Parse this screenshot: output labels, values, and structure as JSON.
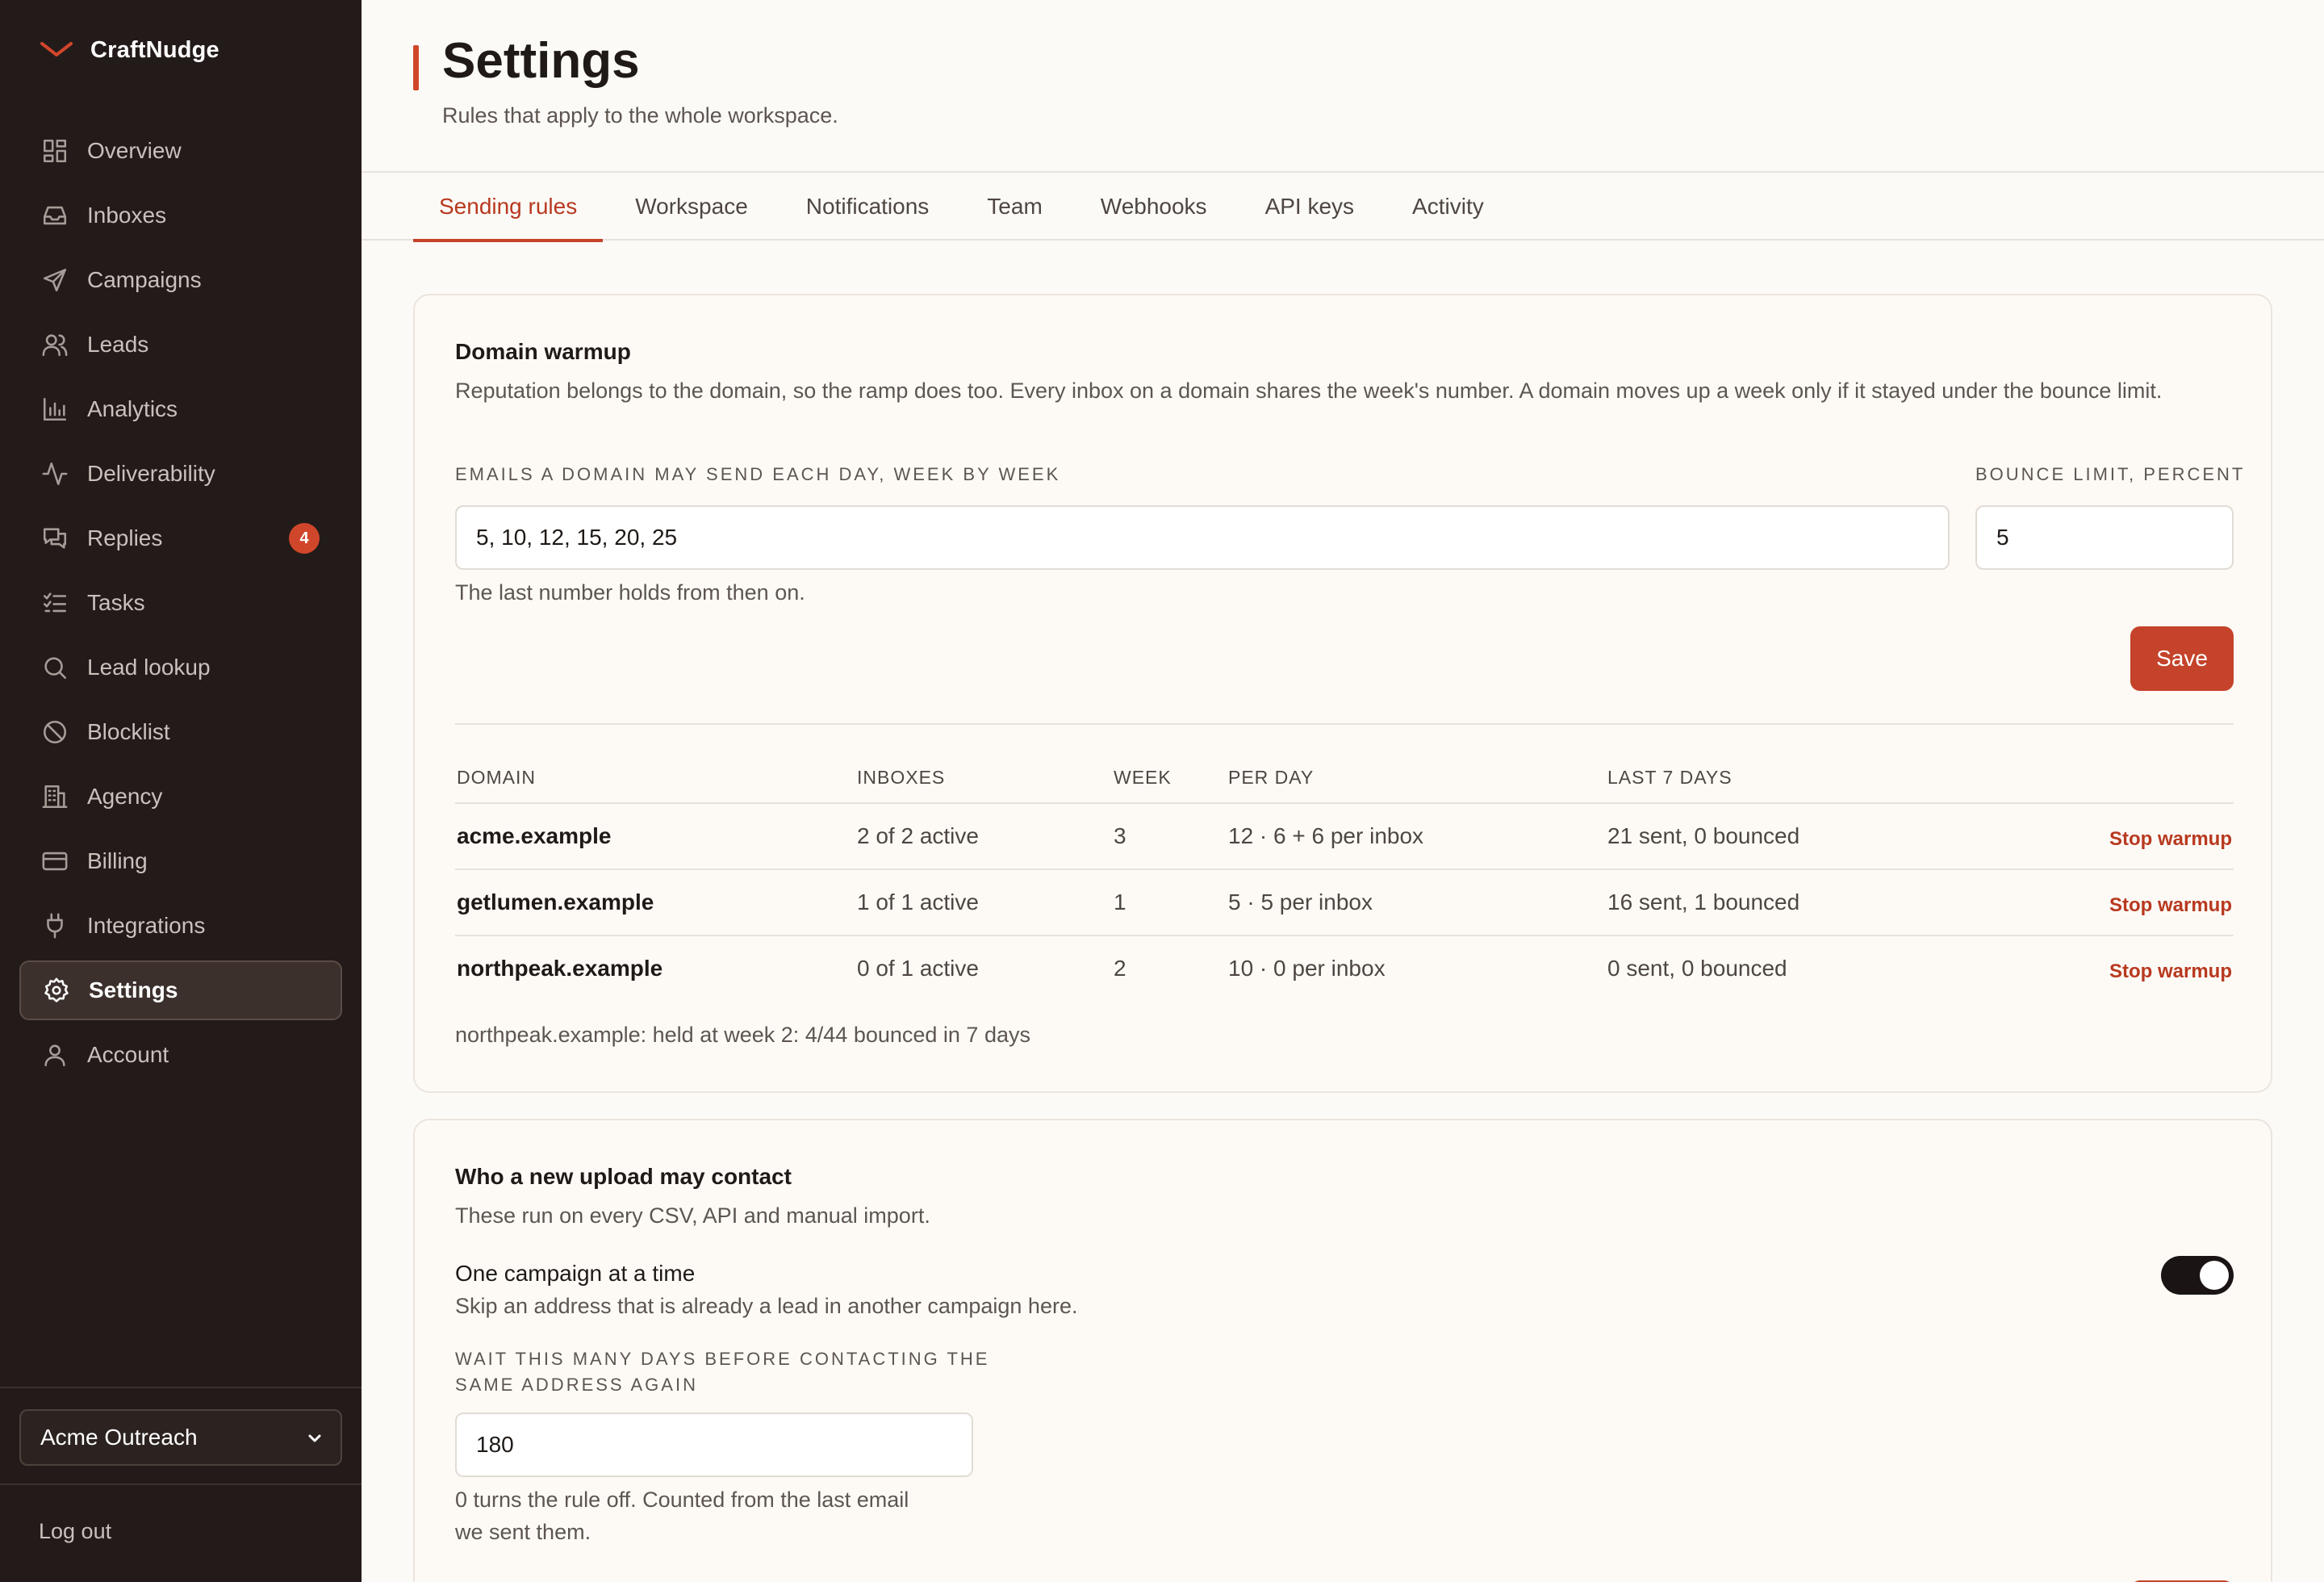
{
  "app": {
    "name": "CraftNudge"
  },
  "sidebar": {
    "items": [
      {
        "label": "Overview",
        "icon": "grid-icon"
      },
      {
        "label": "Inboxes",
        "icon": "inbox-icon"
      },
      {
        "label": "Campaigns",
        "icon": "send-icon"
      },
      {
        "label": "Leads",
        "icon": "users-icon"
      },
      {
        "label": "Analytics",
        "icon": "bar-chart-icon"
      },
      {
        "label": "Deliverability",
        "icon": "pulse-icon"
      },
      {
        "label": "Replies",
        "icon": "chat-icon",
        "badge": "4"
      },
      {
        "label": "Tasks",
        "icon": "checklist-icon"
      },
      {
        "label": "Lead lookup",
        "icon": "search-icon"
      },
      {
        "label": "Blocklist",
        "icon": "ban-icon"
      },
      {
        "label": "Agency",
        "icon": "building-icon"
      },
      {
        "label": "Billing",
        "icon": "credit-card-icon"
      },
      {
        "label": "Integrations",
        "icon": "plug-icon"
      },
      {
        "label": "Settings",
        "icon": "gear-icon",
        "active": true
      },
      {
        "label": "Account",
        "icon": "user-icon"
      }
    ],
    "workspace": "Acme Outreach",
    "logout": "Log out"
  },
  "page": {
    "title": "Settings",
    "subtitle": "Rules that apply to the whole workspace."
  },
  "tabs": [
    "Sending rules",
    "Workspace",
    "Notifications",
    "Team",
    "Webhooks",
    "API keys",
    "Activity"
  ],
  "warmup": {
    "title": "Domain warmup",
    "description": "Reputation belongs to the domain, so the ramp does too. Every inbox on a domain shares the week's number. A domain moves up a week only if it stayed under the bounce limit.",
    "schedule_label": "Emails a domain may send each day, week by week",
    "schedule_value": "5, 10, 12, 15, 20, 25",
    "schedule_hint": "The last number holds from then on.",
    "bounce_label": "Bounce limit, percent",
    "bounce_value": "5",
    "save_label": "Save",
    "columns": [
      "DOMAIN",
      "INBOXES",
      "WEEK",
      "PER DAY",
      "LAST 7 DAYS"
    ],
    "rows": [
      {
        "domain": "acme.example",
        "inboxes": "2 of 2 active",
        "week": "3",
        "per_day": "12 · 6 + 6 per inbox",
        "last7": "21 sent, 0 bounced",
        "action": "Stop warmup"
      },
      {
        "domain": "getlumen.example",
        "inboxes": "1 of 1 active",
        "week": "1",
        "per_day": "5 · 5 per inbox",
        "last7": "16 sent, 1 bounced",
        "action": "Stop warmup"
      },
      {
        "domain": "northpeak.example",
        "inboxes": "0 of 1 active",
        "week": "2",
        "per_day": "10 · 0 per inbox",
        "last7": "0 sent, 0 bounced",
        "action": "Stop warmup"
      }
    ],
    "note": "northpeak.example: held at week 2: 4/44 bounced in 7 days"
  },
  "upload": {
    "title": "Who a new upload may contact",
    "description": "These run on every CSV, API and manual import.",
    "one_campaign_title": "One campaign at a time",
    "one_campaign_desc": "Skip an address that is already a lead in another campaign here.",
    "one_campaign_on": true,
    "wait_label_1": "Wait this many days before contacting the",
    "wait_label_2": "same address again",
    "wait_value": "180",
    "wait_hint_1": "0 turns the rule off. Counted from the last email",
    "wait_hint_2": "we sent them."
  },
  "colors": {
    "accent": "#c4432a",
    "sidebar_bg": "#231b19",
    "page_bg": "#fcfaf7"
  }
}
